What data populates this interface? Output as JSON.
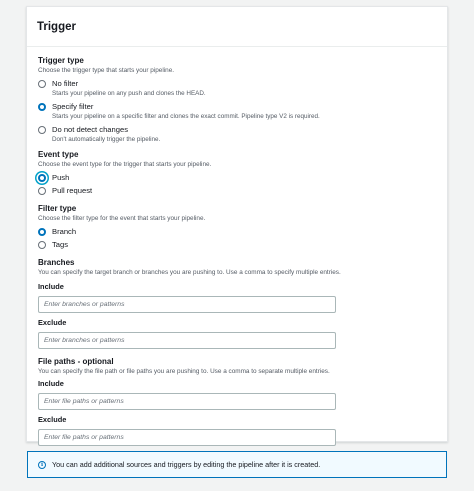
{
  "trigger": {
    "title": "Trigger",
    "trigger_type": {
      "label": "Trigger type",
      "description": "Choose the trigger type that starts your pipeline.",
      "options": [
        {
          "label": "No filter",
          "description": "Starts your pipeline on any push and clones the HEAD.",
          "checked": false
        },
        {
          "label": "Specify filter",
          "description": "Starts your pipeline on a specific filter and clones the exact commit. Pipeline type V2 is required.",
          "checked": true
        },
        {
          "label": "Do not detect changes",
          "description": "Don't automatically trigger the pipeline.",
          "checked": false
        }
      ]
    },
    "event_type": {
      "label": "Event type",
      "description": "Choose the event type for the trigger that starts your pipeline.",
      "options": [
        {
          "label": "Push",
          "checked": true
        },
        {
          "label": "Pull request",
          "checked": false
        }
      ]
    },
    "filter_type": {
      "label": "Filter type",
      "description": "Choose the filter type for the event that starts your pipeline.",
      "options": [
        {
          "label": "Branch",
          "checked": true
        },
        {
          "label": "Tags",
          "checked": false
        }
      ]
    },
    "branches": {
      "label": "Branches",
      "description": "You can specify the target branch or branches you are pushing to. Use a comma to specify multiple entries.",
      "include_label": "Include",
      "include_placeholder": "Enter branches or patterns",
      "exclude_label": "Exclude",
      "exclude_placeholder": "Enter branches or patterns"
    },
    "file_paths": {
      "label": "File paths - optional",
      "description": "You can specify the file path or file paths you are pushing to. Use a comma to separate multiple entries.",
      "include_label": "Include",
      "include_placeholder": "Enter file paths or patterns",
      "exclude_label": "Exclude",
      "exclude_placeholder": "Enter file paths or patterns"
    }
  },
  "info": {
    "icon": "info-icon",
    "text": "You can add additional sources and triggers by editing the pipeline after it is created."
  },
  "colors": {
    "accent": "#0073bb",
    "info_bg": "#f1faff",
    "focus_ring": "#00a1c9"
  }
}
